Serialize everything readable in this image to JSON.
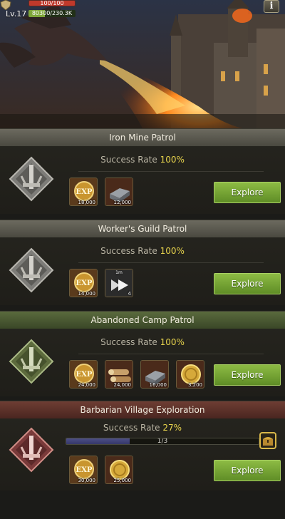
{
  "hud": {
    "hp_text": "100/100",
    "hp_fraction": 1.0,
    "level": "Lv.17",
    "xp_text": "80300/230.3K",
    "xp_fraction": 0.35,
    "info_label": "i"
  },
  "patrols": [
    {
      "title": "Iron Mine Patrol",
      "rate_label": "Success Rate",
      "rate_value": "100%",
      "theme": "grey",
      "rewards": [
        {
          "icon": "exp-icon",
          "tag": "EXP",
          "count": "18,000"
        },
        {
          "icon": "iron-icon",
          "tag": "",
          "count": "12,000"
        }
      ],
      "button": "Explore"
    },
    {
      "title": "Worker's Guild Patrol",
      "rate_label": "Success Rate",
      "rate_value": "100%",
      "theme": "grey",
      "rewards": [
        {
          "icon": "exp-icon",
          "tag": "EXP",
          "count": "14,000"
        },
        {
          "icon": "speedup-icon",
          "tag": "1m",
          "count": "4"
        }
      ],
      "button": "Explore"
    },
    {
      "title": "Abandoned Camp Patrol",
      "rate_label": "Success Rate",
      "rate_value": "100%",
      "theme": "green",
      "rewards": [
        {
          "icon": "exp-icon",
          "tag": "EXP",
          "count": "24,000"
        },
        {
          "icon": "wood-icon",
          "tag": "",
          "count": "24,000"
        },
        {
          "icon": "iron-icon",
          "tag": "",
          "count": "16,000"
        },
        {
          "icon": "gold-coin-icon",
          "tag": "",
          "count": "3,200"
        }
      ],
      "button": "Explore"
    },
    {
      "title": "Barbarian Village Exploration",
      "rate_label": "Success Rate",
      "rate_value": "27%",
      "theme": "red",
      "progress_text": "1/3",
      "progress_fraction": 0.33,
      "rewards": [
        {
          "icon": "exp-icon",
          "tag": "EXP",
          "count": "30,000"
        },
        {
          "icon": "gold-coin-icon",
          "tag": "",
          "count": "25,000"
        }
      ],
      "button": "Explore"
    }
  ],
  "colors": {
    "accent_green": "#7fb23a",
    "rate_yellow": "#e7d34c",
    "header_grey": "#5e5c52",
    "header_green": "#4a5a32",
    "header_red": "#5e322a"
  }
}
